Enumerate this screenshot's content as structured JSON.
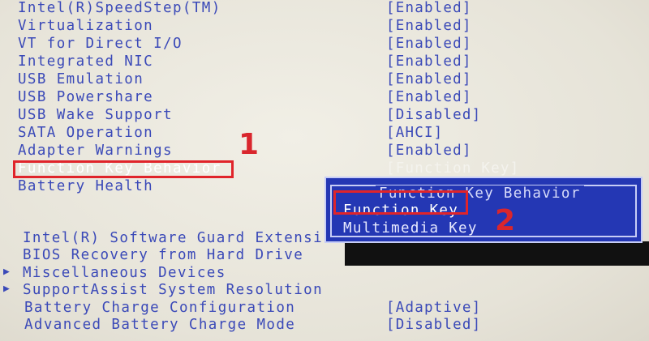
{
  "settings": [
    {
      "label": "Intel(R)SpeedStep(TM)",
      "value": "[Enabled]"
    },
    {
      "label": "Virtualization",
      "value": "[Enabled]"
    },
    {
      "label": "VT for Direct I/O",
      "value": "[Enabled]"
    },
    {
      "label": "Integrated NIC",
      "value": "[Enabled]"
    },
    {
      "label": "USB Emulation",
      "value": "[Enabled]"
    },
    {
      "label": "USB Powershare",
      "value": "[Enabled]"
    },
    {
      "label": "USB Wake Support",
      "value": "[Disabled]"
    },
    {
      "label": "SATA Operation",
      "value": "[AHCI]"
    },
    {
      "label": "Adapter Warnings",
      "value": "[Enabled]"
    },
    {
      "label": "Function Key Behavior",
      "value": "[Function Key]"
    },
    {
      "label": "Battery Health",
      "value": ""
    }
  ],
  "submenus": [
    {
      "label": "Intel(R) Software Guard Extensi",
      "value": ""
    },
    {
      "label": "BIOS Recovery from Hard Drive",
      "value": ""
    },
    {
      "label": "Miscellaneous Devices",
      "value": ""
    },
    {
      "label": "SupportAssist System Resolution",
      "value": ""
    },
    {
      "label": "Battery Charge Configuration",
      "value": "[Adaptive]"
    },
    {
      "label": "Advanced Battery Charge Mode",
      "value": "[Disabled]"
    }
  ],
  "submenu_arrow": "▶",
  "popup": {
    "title": "Function Key Behavior",
    "options": [
      "Function Key",
      "Multimedia Key"
    ]
  },
  "annotations": {
    "step1": "1",
    "step2": "2"
  },
  "colors": {
    "text": "#3a49b8",
    "popup_bg": "#2437b4",
    "highlight": "#e0242a",
    "background": "#e9e6dc"
  }
}
